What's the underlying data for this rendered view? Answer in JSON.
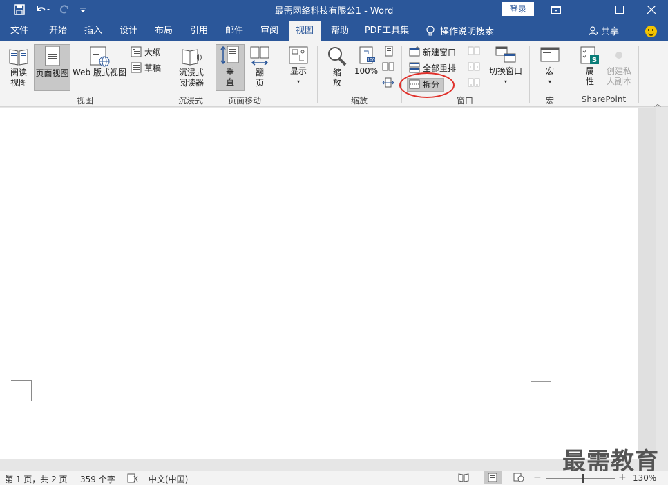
{
  "title_bar": {
    "document_title": "最需网络科技有限公1",
    "separator": " - ",
    "app_name": "Word",
    "login_label": "登录"
  },
  "tabs": [
    {
      "label": "文件",
      "active": false
    },
    {
      "label": "开始",
      "active": false
    },
    {
      "label": "插入",
      "active": false
    },
    {
      "label": "设计",
      "active": false
    },
    {
      "label": "布局",
      "active": false
    },
    {
      "label": "引用",
      "active": false
    },
    {
      "label": "邮件",
      "active": false
    },
    {
      "label": "审阅",
      "active": false
    },
    {
      "label": "视图",
      "active": true
    },
    {
      "label": "帮助",
      "active": false
    },
    {
      "label": "PDF工具集",
      "active": false
    }
  ],
  "tell_me": "操作说明搜索",
  "share": "共享",
  "ribbon": {
    "views": {
      "read_mode_l1": "阅读",
      "read_mode_l2": "视图",
      "print_layout": "页面视图",
      "web_layout": "Web 版式视图",
      "outline": "大纲",
      "draft": "草稿",
      "group_label": "视图"
    },
    "immersive": {
      "reader_l1": "沉浸式",
      "reader_l2": "阅读器",
      "group_label": "沉浸式"
    },
    "page_movement": {
      "vertical_l1": "垂",
      "vertical_l2": "直",
      "side_l1": "翻",
      "side_l2": "页",
      "group_label": "页面移动"
    },
    "show": {
      "label": "显示"
    },
    "zoom": {
      "zoom_l1": "缩",
      "zoom_l2": "放",
      "hundred": "100%",
      "group_label": "缩放"
    },
    "window": {
      "new_window": "新建窗口",
      "arrange_all": "全部重排",
      "split": "拆分",
      "switch_windows": "切换窗口",
      "group_label": "窗口"
    },
    "macros": {
      "label": "宏",
      "group_label": "宏"
    },
    "sharepoint": {
      "properties_l1": "属",
      "properties_l2": "性",
      "private_copy_l1": "创建私",
      "private_copy_l2": "人副本",
      "group_label": "SharePoint"
    }
  },
  "status_bar": {
    "page_info": "第 1 页，共 2 页",
    "word_count": "359 个字",
    "language": "中文(中国)",
    "zoom_level": "130%",
    "zoom_minus": "−",
    "zoom_plus": "+"
  },
  "watermark": "最需教育",
  "colors": {
    "brand_blue": "#2b579a",
    "ribbon_bg": "#f3f3f3",
    "highlight_red": "#e0302a"
  }
}
